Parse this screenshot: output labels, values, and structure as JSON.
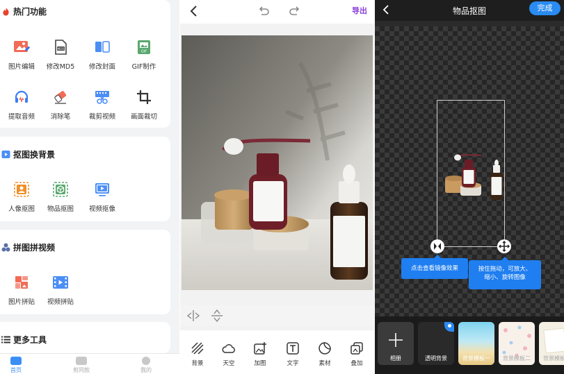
{
  "panel1": {
    "sections": [
      {
        "title": "热门功能",
        "items": [
          {
            "label": "图片编辑",
            "icon": "image-edit-icon"
          },
          {
            "label": "修改MD5",
            "icon": "md5-icon"
          },
          {
            "label": "修改封面",
            "icon": "cover-icon"
          },
          {
            "label": "GIF制作",
            "icon": "gif-icon"
          },
          {
            "label": "提取音频",
            "icon": "headphones-icon"
          },
          {
            "label": "消除笔",
            "icon": "eraser-icon"
          },
          {
            "label": "裁剪视频",
            "icon": "film-cut-icon"
          },
          {
            "label": "画面裁切",
            "icon": "crop-icon"
          }
        ]
      },
      {
        "title": "抠图换背景",
        "items": [
          {
            "label": "人像抠图",
            "icon": "portrait-cutout-icon"
          },
          {
            "label": "物品抠图",
            "icon": "object-cutout-icon"
          },
          {
            "label": "视频抠像",
            "icon": "video-cutout-icon"
          }
        ]
      },
      {
        "title": "拼图拼视频",
        "items": [
          {
            "label": "图片拼贴",
            "icon": "collage-icon"
          },
          {
            "label": "视频拼贴",
            "icon": "video-collage-icon"
          }
        ]
      },
      {
        "title": "更多工具",
        "items": []
      }
    ],
    "tabs": [
      {
        "label": "首页",
        "active": true
      },
      {
        "label": "剪同款",
        "active": false
      },
      {
        "label": "我的",
        "active": false
      }
    ]
  },
  "panel2": {
    "export_label": "导出",
    "tools": [
      {
        "label": "背景",
        "icon": "background-icon"
      },
      {
        "label": "天空",
        "icon": "sky-icon"
      },
      {
        "label": "加图",
        "icon": "add-image-icon"
      },
      {
        "label": "文字",
        "icon": "text-icon"
      },
      {
        "label": "素材",
        "icon": "sticker-icon"
      },
      {
        "label": "叠加",
        "icon": "overlay-icon"
      }
    ]
  },
  "panel3": {
    "title": "物品抠图",
    "done_label": "完成",
    "tip_mirror": "点击查看镜像效果",
    "tip_move_line1": "按住拖动，可放大、",
    "tip_move_line2": "缩小、旋转图像",
    "backgrounds": [
      {
        "label": "相册"
      },
      {
        "label": "透明背景"
      },
      {
        "label": "背景模板一"
      },
      {
        "label": "背景模板二"
      },
      {
        "label": "背景模板三"
      }
    ]
  },
  "colors": {
    "accent_blue": "#2a8bf2",
    "export_purple": "#8a3fd9",
    "fire_red": "#e8422c"
  }
}
